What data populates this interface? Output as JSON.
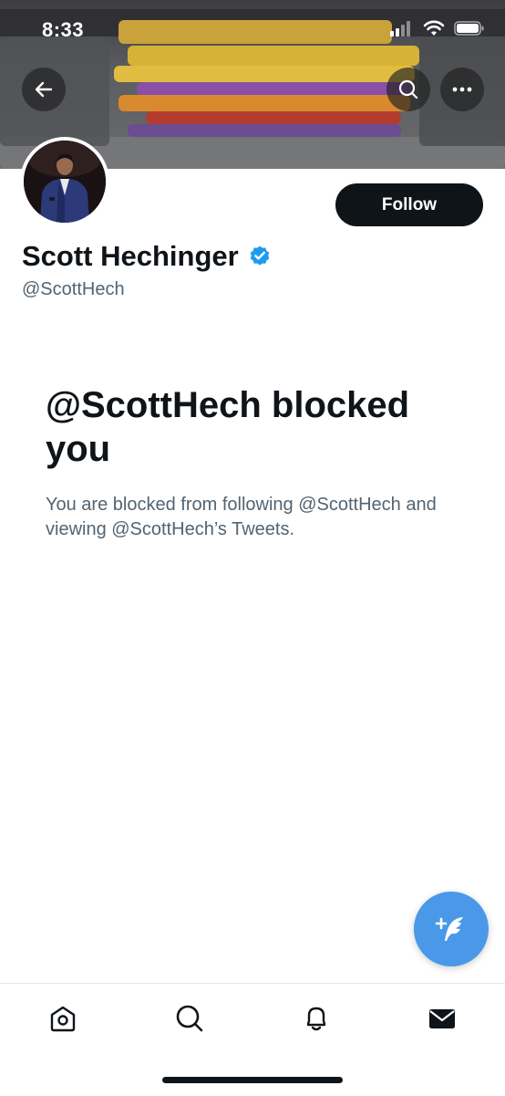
{
  "status_bar": {
    "time": "8:33"
  },
  "header": {
    "back_icon": "arrow-left-icon",
    "search_icon": "search-icon",
    "more_icon": "more-horizontal-icon"
  },
  "profile": {
    "display_name": "Scott Hechinger",
    "handle": "@ScottHech",
    "verified": true,
    "follow_label": "Follow"
  },
  "blocked": {
    "title": "@ScottHech blocked you",
    "description": "You are blocked from following @ScottHech and viewing @ScottHech’s Tweets."
  },
  "fab": {
    "icon": "compose-tweet-icon"
  },
  "tabbar": {
    "items": [
      {
        "name": "home",
        "icon": "home-icon"
      },
      {
        "name": "search",
        "icon": "search-icon"
      },
      {
        "name": "notifications",
        "icon": "bell-icon"
      },
      {
        "name": "messages",
        "icon": "envelope-icon"
      }
    ]
  },
  "colors": {
    "accent": "#4a99e9",
    "verified": "#1d9bf0",
    "text_primary": "#0f1419",
    "text_secondary": "#536471"
  }
}
